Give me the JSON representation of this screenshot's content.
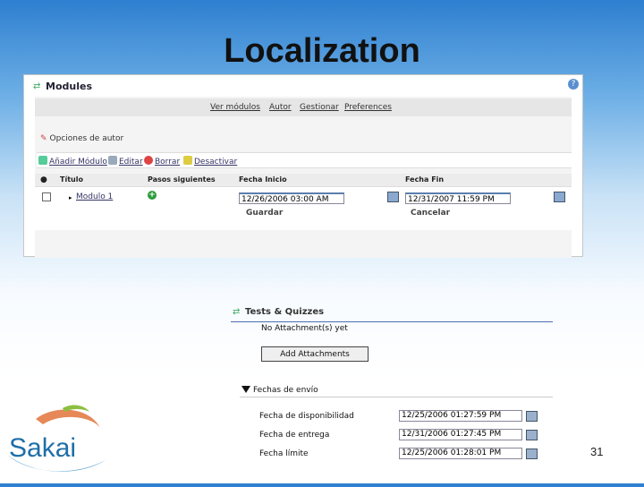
{
  "slide": {
    "title": "Localization",
    "page_number": "31"
  },
  "modules": {
    "title": "Modules",
    "help": "?",
    "nav": [
      "Ver módulos",
      "Autor",
      "Gestionar",
      "Preferences"
    ],
    "options_label": "Opciones de autor",
    "actions": [
      "Añadir Módulo",
      "Editar",
      "Borrar",
      "Desactivar"
    ],
    "columns": [
      "Título",
      "Pasos siguientes",
      "Fecha Inicio",
      "Fecha Fin"
    ],
    "row": {
      "module_link": "Modulo 1",
      "start_date": "12/26/2006 03:00 AM",
      "end_date": "12/31/2007 11:59 PM"
    },
    "save_label": "Guardar",
    "cancel_label": "Cancelar"
  },
  "quizzes": {
    "title": "Tests & Quizzes",
    "no_attachments": "No Attachment(s) yet",
    "add_attachments": "Add Attachments",
    "section": "Fechas de envío",
    "fields": [
      {
        "label": "Fecha de disponibilidad",
        "value": "12/25/2006 01:27:59 PM"
      },
      {
        "label": "Fecha de entrega",
        "value": "12/31/2006 01:27:45 PM"
      },
      {
        "label": "Fecha límite",
        "value": "12/25/2006 01:28:01 PM"
      }
    ]
  },
  "logo": {
    "text": "Sakai"
  },
  "colors": {
    "background_top": "#2e7fd0",
    "accent": "#4a70b0",
    "logo_blue": "#1f6fa8",
    "logo_orange": "#e2733a",
    "logo_green": "#8cbf3f"
  }
}
